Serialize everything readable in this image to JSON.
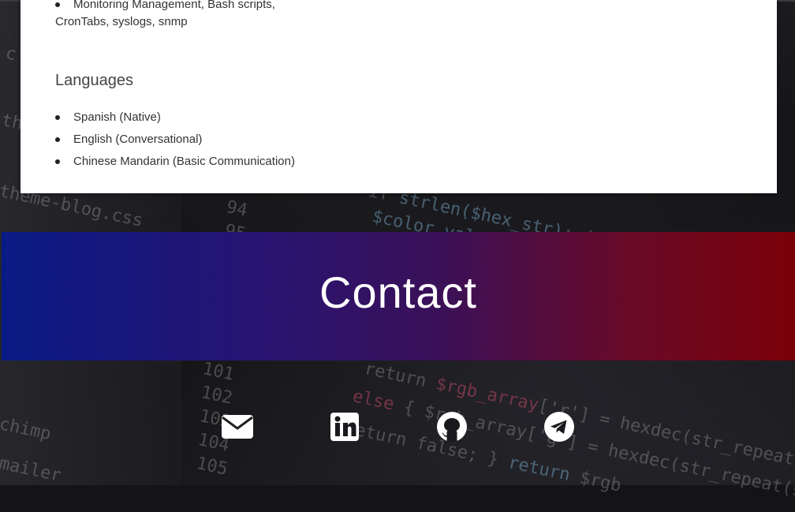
{
  "skills": {
    "partial_item": "Monitoring Management, Bash scripts,",
    "partial_item_continued": "CronTabs, syslogs, snmp"
  },
  "languages": {
    "title": "Languages",
    "items": [
      "Spanish (Native)",
      "English (Conversational)",
      "Chinese Mandarin (Basic Communication)"
    ]
  },
  "contact": {
    "title": "Contact",
    "links": [
      {
        "icon": "envelope-icon",
        "name": "email"
      },
      {
        "icon": "linkedin-icon",
        "name": "linkedin"
      },
      {
        "icon": "github-icon",
        "name": "github"
      },
      {
        "icon": "telegram-icon",
        "name": "telegram"
      }
    ]
  },
  "colors": {
    "banner_left": "#0a1a85",
    "banner_right": "#7a0008",
    "card": "#ffffff"
  }
}
